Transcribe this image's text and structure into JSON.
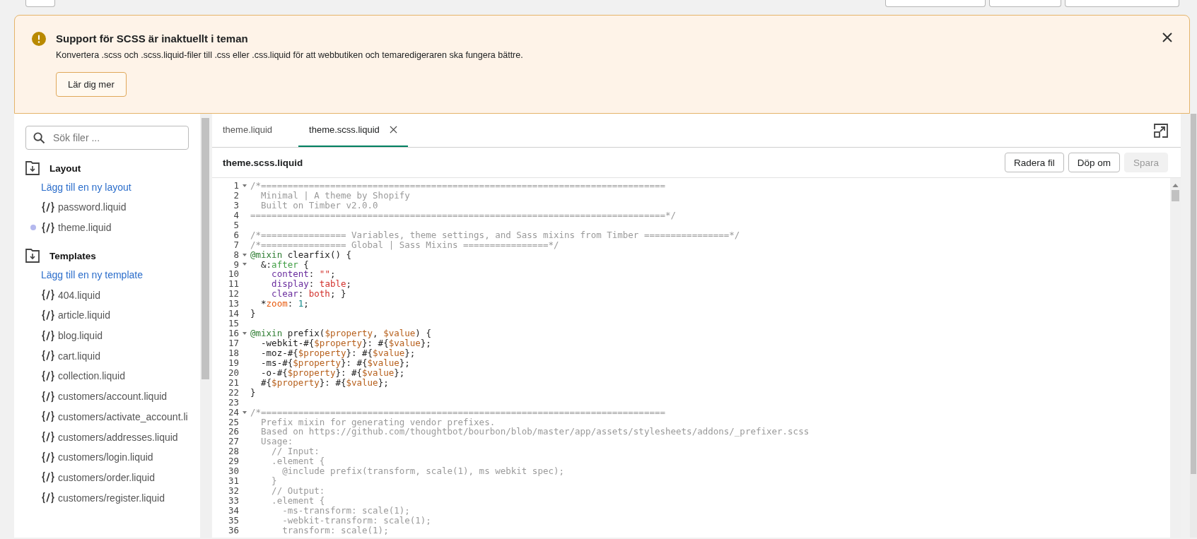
{
  "banner": {
    "title": "Support för SCSS är inaktuellt i teman",
    "message": "Konvertera .scss och .scss.liquid-filer till .css eller .css.liquid för att webbutiken och temaredigeraren ska fungera bättre.",
    "button": "Lär dig mer"
  },
  "sidebar": {
    "search": {
      "placeholder": "Sök filer ..."
    },
    "sections": [
      {
        "title": "Layout",
        "add_link": "Lägg till en ny layout",
        "files": [
          {
            "name": "password.liquid",
            "selected": false
          },
          {
            "name": "theme.liquid",
            "selected": true
          }
        ]
      },
      {
        "title": "Templates",
        "add_link": "Lägg till en ny template",
        "files": [
          {
            "name": "404.liquid",
            "selected": false
          },
          {
            "name": "article.liquid",
            "selected": false
          },
          {
            "name": "blog.liquid",
            "selected": false
          },
          {
            "name": "cart.liquid",
            "selected": false
          },
          {
            "name": "collection.liquid",
            "selected": false
          },
          {
            "name": "customers/account.liquid",
            "selected": false
          },
          {
            "name": "customers/activate_account.li",
            "selected": false
          },
          {
            "name": "customers/addresses.liquid",
            "selected": false
          },
          {
            "name": "customers/login.liquid",
            "selected": false
          },
          {
            "name": "customers/order.liquid",
            "selected": false
          },
          {
            "name": "customers/register.liquid",
            "selected": false
          }
        ]
      }
    ]
  },
  "editor": {
    "tabs": [
      {
        "label": "theme.liquid",
        "selected": false
      },
      {
        "label": "theme.scss.liquid",
        "selected": true
      }
    ],
    "file_title": "theme.scss.liquid",
    "actions": [
      {
        "label": "Radera fil",
        "disabled": false
      },
      {
        "label": "Döp om",
        "disabled": false
      },
      {
        "label": "Spara",
        "disabled": true
      }
    ],
    "lines": [
      {
        "number": "1",
        "foldable": true,
        "tokens": [
          {
            "kind": "comment",
            "text": "/*============================================================================"
          }
        ]
      },
      {
        "number": "2",
        "foldable": false,
        "tokens": [
          {
            "kind": "comment",
            "text": "  Minimal | A theme by Shopify"
          }
        ]
      },
      {
        "number": "3",
        "foldable": false,
        "tokens": [
          {
            "kind": "comment",
            "text": "  Built on Timber v2.0.0"
          }
        ]
      },
      {
        "number": "4",
        "foldable": false,
        "tokens": [
          {
            "kind": "comment",
            "text": "==============================================================================*/"
          }
        ]
      },
      {
        "number": "5",
        "foldable": false
      },
      {
        "number": "6",
        "foldable": false,
        "tokens": [
          {
            "kind": "comment",
            "text": "/*================ Variables, theme settings, and Sass mixins from Timber ================*/"
          }
        ]
      },
      {
        "number": "7",
        "foldable": false,
        "tokens": [
          {
            "kind": "comment",
            "text": "/*================ Global | Sass Mixins ================*/"
          }
        ]
      },
      {
        "number": "8",
        "foldable": true,
        "tokens": [
          {
            "kind": "atrule",
            "text": "@mixin"
          },
          {
            "kind": "plain",
            "text": " clearfix() {"
          }
        ]
      },
      {
        "number": "9",
        "foldable": true,
        "tokens": [
          {
            "kind": "plain",
            "text": "  &:"
          },
          {
            "kind": "pseudo",
            "text": "after"
          },
          {
            "kind": "plain",
            "text": " {"
          }
        ]
      },
      {
        "number": "10",
        "foldable": false,
        "tokens": [
          {
            "kind": "property",
            "text": "    content"
          },
          {
            "kind": "plain",
            "text": ": "
          },
          {
            "kind": "value",
            "text": "\"\""
          },
          {
            "kind": "plain",
            "text": ";"
          }
        ]
      },
      {
        "number": "11",
        "foldable": false,
        "tokens": [
          {
            "kind": "property",
            "text": "    display"
          },
          {
            "kind": "plain",
            "text": ": "
          },
          {
            "kind": "value",
            "text": "table"
          },
          {
            "kind": "plain",
            "text": ";"
          }
        ]
      },
      {
        "number": "12",
        "foldable": false,
        "tokens": [
          {
            "kind": "property",
            "text": "    clear"
          },
          {
            "kind": "plain",
            "text": ": "
          },
          {
            "kind": "value",
            "text": "both"
          },
          {
            "kind": "plain",
            "text": "; }"
          }
        ]
      },
      {
        "number": "13",
        "foldable": false,
        "tokens": [
          {
            "kind": "plain",
            "text": "  *"
          },
          {
            "kind": "hack",
            "text": "zoom"
          },
          {
            "kind": "plain",
            "text": ": "
          },
          {
            "kind": "number",
            "text": "1"
          },
          {
            "kind": "plain",
            "text": ";"
          }
        ]
      },
      {
        "number": "14",
        "foldable": false,
        "tokens": [
          {
            "kind": "plain",
            "text": "}"
          }
        ]
      },
      {
        "number": "15",
        "foldable": false
      },
      {
        "number": "16",
        "foldable": true,
        "tokens": [
          {
            "kind": "atrule",
            "text": "@mixin"
          },
          {
            "kind": "plain",
            "text": " prefix("
          },
          {
            "kind": "variable",
            "text": "$property"
          },
          {
            "kind": "plain",
            "text": ", "
          },
          {
            "kind": "variable",
            "text": "$value"
          },
          {
            "kind": "plain",
            "text": ") {"
          }
        ]
      },
      {
        "number": "17",
        "foldable": false,
        "tokens": [
          {
            "kind": "plain",
            "text": "  -webkit-#{"
          },
          {
            "kind": "variable",
            "text": "$property"
          },
          {
            "kind": "plain",
            "text": "}: #{"
          },
          {
            "kind": "variable",
            "text": "$value"
          },
          {
            "kind": "plain",
            "text": "};"
          }
        ]
      },
      {
        "number": "18",
        "foldable": false,
        "tokens": [
          {
            "kind": "plain",
            "text": "  -moz-#{"
          },
          {
            "kind": "variable",
            "text": "$property"
          },
          {
            "kind": "plain",
            "text": "}: #{"
          },
          {
            "kind": "variable",
            "text": "$value"
          },
          {
            "kind": "plain",
            "text": "};"
          }
        ]
      },
      {
        "number": "19",
        "foldable": false,
        "tokens": [
          {
            "kind": "plain",
            "text": "  -ms-#{"
          },
          {
            "kind": "variable",
            "text": "$property"
          },
          {
            "kind": "plain",
            "text": "}: #{"
          },
          {
            "kind": "variable",
            "text": "$value"
          },
          {
            "kind": "plain",
            "text": "};"
          }
        ]
      },
      {
        "number": "20",
        "foldable": false,
        "tokens": [
          {
            "kind": "plain",
            "text": "  -o-#{"
          },
          {
            "kind": "variable",
            "text": "$property"
          },
          {
            "kind": "plain",
            "text": "}: #{"
          },
          {
            "kind": "variable",
            "text": "$value"
          },
          {
            "kind": "plain",
            "text": "};"
          }
        ]
      },
      {
        "number": "21",
        "foldable": false,
        "tokens": [
          {
            "kind": "plain",
            "text": "  #{"
          },
          {
            "kind": "variable",
            "text": "$property"
          },
          {
            "kind": "plain",
            "text": "}: #{"
          },
          {
            "kind": "variable",
            "text": "$value"
          },
          {
            "kind": "plain",
            "text": "};"
          }
        ]
      },
      {
        "number": "22",
        "foldable": false,
        "tokens": [
          {
            "kind": "plain",
            "text": "}"
          }
        ]
      },
      {
        "number": "23",
        "foldable": false
      },
      {
        "number": "24",
        "foldable": true,
        "tokens": [
          {
            "kind": "comment",
            "text": "/*============================================================================"
          }
        ]
      },
      {
        "number": "25",
        "foldable": false,
        "tokens": [
          {
            "kind": "comment",
            "text": "  Prefix mixin for generating vendor prefixes."
          }
        ]
      },
      {
        "number": "26",
        "foldable": false,
        "tokens": [
          {
            "kind": "comment",
            "text": "  Based on https://github.com/thoughtbot/bourbon/blob/master/app/assets/stylesheets/addons/_prefixer.scss"
          }
        ]
      },
      {
        "number": "27",
        "foldable": false,
        "tokens": [
          {
            "kind": "comment",
            "text": "  Usage:"
          }
        ]
      },
      {
        "number": "28",
        "foldable": false,
        "tokens": [
          {
            "kind": "comment",
            "text": "    // Input:"
          }
        ]
      },
      {
        "number": "29",
        "foldable": false,
        "tokens": [
          {
            "kind": "comment",
            "text": "    .element {"
          }
        ]
      },
      {
        "number": "30",
        "foldable": false,
        "tokens": [
          {
            "kind": "comment",
            "text": "      @include prefix(transform, scale(1), ms webkit spec);"
          }
        ]
      },
      {
        "number": "31",
        "foldable": false,
        "tokens": [
          {
            "kind": "comment",
            "text": "    }"
          }
        ]
      },
      {
        "number": "32",
        "foldable": false,
        "tokens": [
          {
            "kind": "comment",
            "text": "    // Output:"
          }
        ]
      },
      {
        "number": "33",
        "foldable": false,
        "tokens": [
          {
            "kind": "comment",
            "text": "    .element {"
          }
        ]
      },
      {
        "number": "34",
        "foldable": false,
        "tokens": [
          {
            "kind": "comment",
            "text": "      -ms-transform: scale(1);"
          }
        ]
      },
      {
        "number": "35",
        "foldable": false,
        "tokens": [
          {
            "kind": "comment",
            "text": "      -webkit-transform: scale(1);"
          }
        ]
      },
      {
        "number": "36",
        "foldable": false,
        "tokens": [
          {
            "kind": "comment",
            "text": "      transform: scale(1);"
          }
        ]
      }
    ]
  }
}
